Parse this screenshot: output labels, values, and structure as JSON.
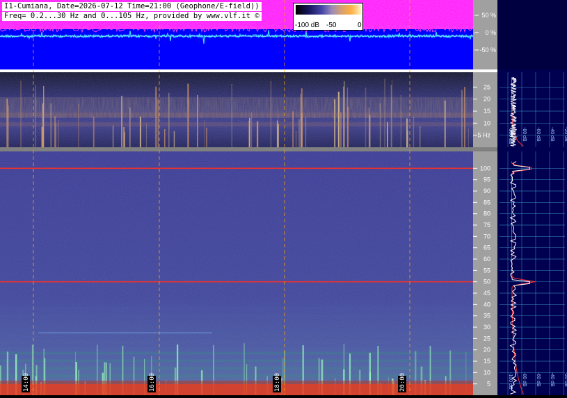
{
  "header": {
    "line1": "I1-Cumiana, Date=2026-07-12 Time=21:00 (Geophone/E-field))",
    "line2": "Freq= 0.2...30 Hz and 0...105 Hz, provided by www.vlf.it ©"
  },
  "colorbar": {
    "labels": [
      "-100 dB",
      "-50",
      "0"
    ]
  },
  "colors": {
    "waveform_bg": "#0000ff",
    "waveform_trace": "#33e0ff",
    "envelope": "#ff00ff",
    "spectrum_bg": "#3a3a92",
    "marker_line": "#ffaa00",
    "mains_line": "#ff3020",
    "axis_panel": "#a0a0a0",
    "profile_bg": "#000050",
    "profile_grid": "#3c96c8"
  },
  "chart_data": [
    {
      "type": "line",
      "title": "",
      "description_of_panel": "",
      "ylabel": "",
      "y_ticks": [
        "50 %",
        "0 %",
        "-50 %"
      ],
      "ylim": [
        -100,
        100
      ],
      "series": [
        {
          "name": "",
          "role": "peak envelope"
        },
        {
          "name": "",
          "role": "waveform"
        }
      ]
    },
    {
      "type": "heatmap",
      "ylabel": "",
      "ylim": [
        0,
        30
      ],
      "y_ticks": [
        "25",
        "20",
        "15",
        "10",
        "5 Hz"
      ],
      "y_tick_values": [
        25,
        20,
        15,
        10,
        5
      ],
      "x_time_markers": [
        "14:00",
        "16:00",
        "18:00",
        "20:00"
      ],
      "bright_bands_hz": [
        13.5,
        9.5
      ]
    },
    {
      "type": "heatmap",
      "ylabel": "",
      "ylim": [
        0,
        105
      ],
      "y_ticks": [
        "100",
        "95",
        "90",
        "85",
        "80",
        "75",
        "70",
        "65",
        "60",
        "55",
        "50",
        "45",
        "40",
        "35",
        "30",
        "25",
        "20",
        "15",
        "10",
        "5"
      ],
      "y_tick_values": [
        100,
        95,
        90,
        85,
        80,
        75,
        70,
        65,
        60,
        55,
        50,
        45,
        40,
        35,
        30,
        25,
        20,
        15,
        10,
        5
      ],
      "x_time_markers": [
        "14:00",
        "16:00",
        "18:00",
        "20:00"
      ],
      "spectral_lines_hz": [
        100,
        50,
        27.5
      ]
    },
    {
      "type": "line",
      "role": "low-band level profile",
      "x_ticks": [
        "-100 dB",
        "-80 dB",
        "-60 dB",
        "-40 dB",
        "-20 dB"
      ],
      "xlim": [
        -100,
        -20
      ],
      "ylim": [
        0,
        30
      ]
    },
    {
      "type": "line",
      "role": "high-band level profile",
      "x_ticks": [
        "-100 dB",
        "-80 dB",
        "-60 dB",
        "-40 dB",
        "-20 dB"
      ],
      "xlim": [
        -100,
        -20
      ],
      "ylim": [
        0,
        105
      ],
      "peaks_hz": [
        100,
        50
      ]
    }
  ]
}
